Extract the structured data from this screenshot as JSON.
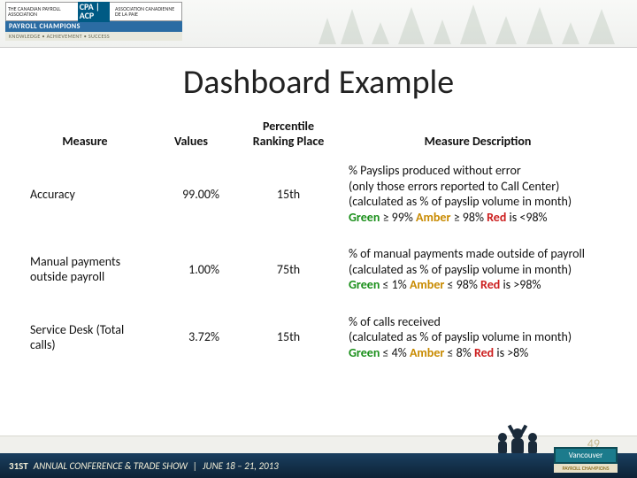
{
  "header": {
    "org_left": "THE CANADIAN PAYROLL ASSOCIATION",
    "org_right": "ASSOCIATION CANADIENNE DE LA PAIE",
    "logo_abbr": "CPA | ACP",
    "banner_line1": "PAYROLL CHAMPIONS",
    "banner_line2": "KNOWLEDGE • ACHIEVEMENT • SUCCESS"
  },
  "title": "Dashboard Example",
  "table": {
    "headers": {
      "measure": "Measure",
      "values": "Values",
      "rank": "Percentile Ranking Place",
      "desc": "Measure Description"
    },
    "rows": [
      {
        "measure": "Accuracy",
        "value": "99.00%",
        "rank": "15th",
        "desc_lines": [
          "% Payslips produced without error",
          "(only those errors reported to Call Center)",
          "(calculated as % of payslip volume in month)"
        ],
        "threshold": {
          "green": "≥ 99%",
          "amber": "≥ 98%",
          "red": "is <98%"
        }
      },
      {
        "measure": "Manual payments outside payroll",
        "value": "1.00%",
        "rank": "75th",
        "desc_lines": [
          "% of manual payments made outside of payroll",
          "(calculated as % of payslip volume in month)"
        ],
        "threshold": {
          "green": "≤ 1%",
          "amber": "≤ 98%",
          "red": "is >98%"
        }
      },
      {
        "measure": "Service Desk (Total calls)",
        "value": "3.72%",
        "rank": "15th",
        "desc_lines": [
          "% of calls received",
          "(calculated as % of payslip volume in month)"
        ],
        "threshold": {
          "green": "≤ 4%",
          "amber": "≤ 8%",
          "red": "is >8%"
        }
      }
    ]
  },
  "threshold_labels": {
    "green": "Green",
    "amber": "Amber",
    "red": "Red"
  },
  "footer": {
    "conf": "31ST",
    "conf_text": "ANNUAL CONFERENCE & TRADE SHOW",
    "dates": "JUNE 18 – 21, 2013",
    "city": "Vancouver",
    "page": "49"
  }
}
